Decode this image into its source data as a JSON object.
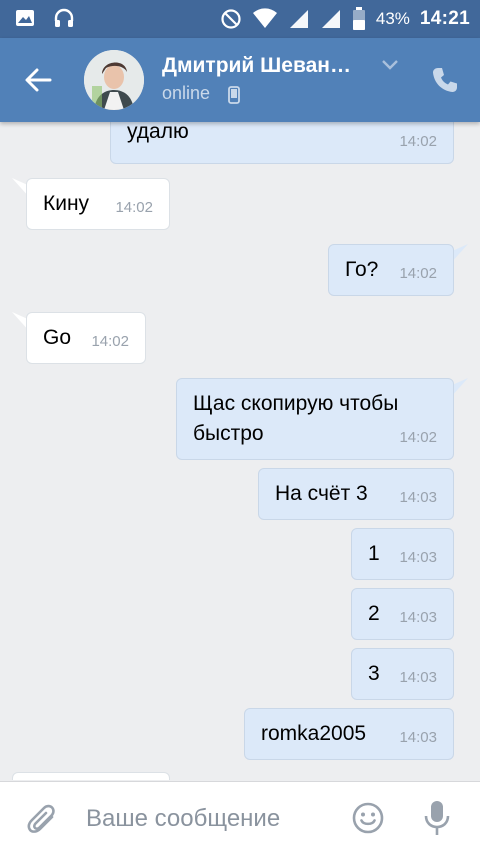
{
  "status_bar": {
    "battery_percent": "43%",
    "time": "14:21",
    "icons": [
      "image-icon",
      "headset-icon",
      "do-not-disturb-icon",
      "wifi-icon",
      "signal-icon",
      "signal-icon",
      "battery-icon"
    ]
  },
  "header": {
    "contact_name": "Дмитрий Шеван…",
    "presence": "online",
    "icons": [
      "back-arrow-icon",
      "chevron-down-icon",
      "mobile-device-icon",
      "phone-icon"
    ]
  },
  "messages": [
    {
      "direction": "out",
      "text": "удалю",
      "time": "14:02"
    },
    {
      "direction": "in",
      "text": "Кину",
      "time": "14:02"
    },
    {
      "direction": "out",
      "text": "Го?",
      "time": "14:02"
    },
    {
      "direction": "in",
      "text": "Go",
      "time": "14:02"
    },
    {
      "direction": "out",
      "text": "Щас скопирую чтобы быстро",
      "time": "14:02"
    },
    {
      "direction": "out",
      "text": "На счёт 3",
      "time": "14:03"
    },
    {
      "direction": "out",
      "text": "1",
      "time": "14:03"
    },
    {
      "direction": "out",
      "text": "2",
      "time": "14:03"
    },
    {
      "direction": "out",
      "text": "3",
      "time": "14:03"
    },
    {
      "direction": "out",
      "text": "romka2005",
      "time": "14:03"
    }
  ],
  "composer": {
    "placeholder": "Ваше сообщение",
    "icons": [
      "paperclip-icon",
      "emoji-icon",
      "microphone-icon"
    ]
  },
  "colors": {
    "header": "#5181b8",
    "status_bar": "#41689a",
    "background": "#edeef0",
    "incoming_bubble": "#ffffff",
    "outgoing_bubble": "#dce9f9"
  }
}
